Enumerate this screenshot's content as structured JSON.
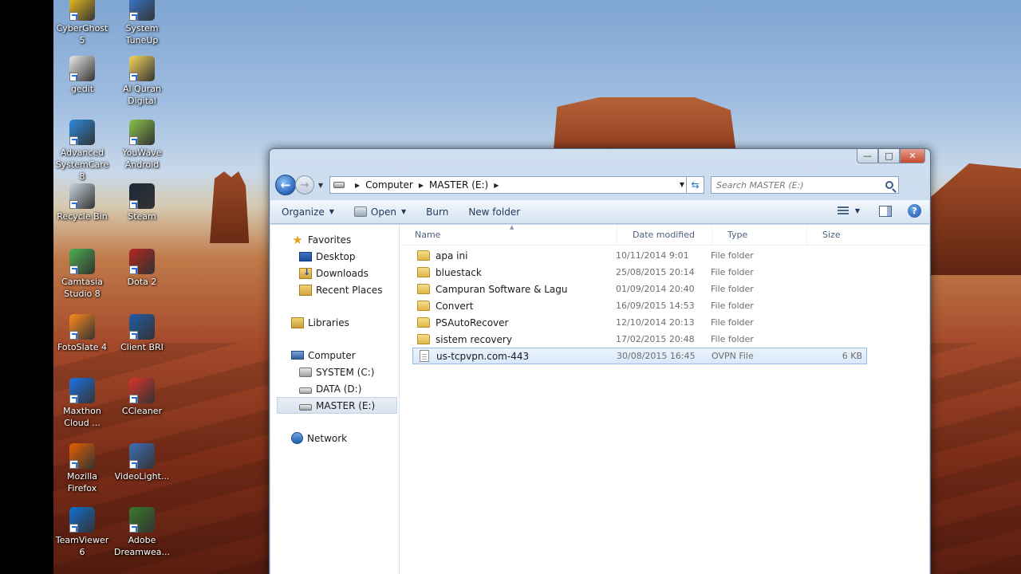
{
  "desktop_icons": [
    {
      "label": "CyberGhost 5",
      "color": "#f2c21b"
    },
    {
      "label": "System TuneUp",
      "color": "#3a7bd5"
    },
    {
      "label": "gedit",
      "color": "#e9e9e9"
    },
    {
      "label": "Al Quran Digital",
      "color": "#f5d65a"
    },
    {
      "label": "Advanced SystemCare 8",
      "color": "#2b8be0"
    },
    {
      "label": "YouWave Android",
      "color": "#8bc34a"
    },
    {
      "label": "Recycle Bin",
      "color": "#c9d4de"
    },
    {
      "label": "Steam",
      "color": "#1b2838"
    },
    {
      "label": "Camtasia Studio 8",
      "color": "#4caf50"
    },
    {
      "label": "Dota 2",
      "color": "#b3261e"
    },
    {
      "label": "FotoSlate 4",
      "color": "#ff8a1c"
    },
    {
      "label": "Client BRI",
      "color": "#1f5ca8"
    },
    {
      "label": "Maxthon Cloud ...",
      "color": "#1a73e8"
    },
    {
      "label": "CCleaner",
      "color": "#d9342b"
    },
    {
      "label": "Mozilla Firefox",
      "color": "#e66000"
    },
    {
      "label": "VideoLight...",
      "color": "#3f6fb5"
    },
    {
      "label": "TeamViewer 6",
      "color": "#0e6fd1"
    },
    {
      "label": "Adobe Dreamwea...",
      "color": "#3b7a2a"
    }
  ],
  "window": {
    "controls": {
      "minimize": "—",
      "maximize": "□",
      "close": "✕"
    },
    "address": {
      "crumbs": [
        "Computer",
        "MASTER (E:)"
      ]
    },
    "search": {
      "placeholder": "Search MASTER (E:)"
    },
    "toolbar": {
      "organize": "Organize",
      "open": "Open",
      "burn": "Burn",
      "new_folder": "New folder"
    },
    "nav": {
      "favorites": "Favorites",
      "desktop": "Desktop",
      "downloads": "Downloads",
      "recent": "Recent Places",
      "libraries": "Libraries",
      "computer": "Computer",
      "system": "SYSTEM (C:)",
      "data": "DATA (D:)",
      "master": "MASTER (E:)",
      "network": "Network"
    },
    "columns": {
      "name": "Name",
      "date": "Date modified",
      "type": "Type",
      "size": "Size"
    },
    "files": [
      {
        "name": "apa ini",
        "date": "10/11/2014 9:01",
        "type": "File folder",
        "size": "",
        "kind": "folder"
      },
      {
        "name": "bluestack",
        "date": "25/08/2015 20:14",
        "type": "File folder",
        "size": "",
        "kind": "folder"
      },
      {
        "name": "Campuran Software & Lagu",
        "date": "01/09/2014 20:40",
        "type": "File folder",
        "size": "",
        "kind": "folder"
      },
      {
        "name": "Convert",
        "date": "16/09/2015 14:53",
        "type": "File folder",
        "size": "",
        "kind": "folder"
      },
      {
        "name": "PSAutoRecover",
        "date": "12/10/2014 20:13",
        "type": "File folder",
        "size": "",
        "kind": "folder"
      },
      {
        "name": "sistem recovery",
        "date": "17/02/2015 20:48",
        "type": "File folder",
        "size": "",
        "kind": "folder"
      },
      {
        "name": "us-tcpvpn.com-443",
        "date": "30/08/2015 16:45",
        "type": "OVPN File",
        "size": "6 KB",
        "kind": "file",
        "selected": true
      }
    ]
  }
}
